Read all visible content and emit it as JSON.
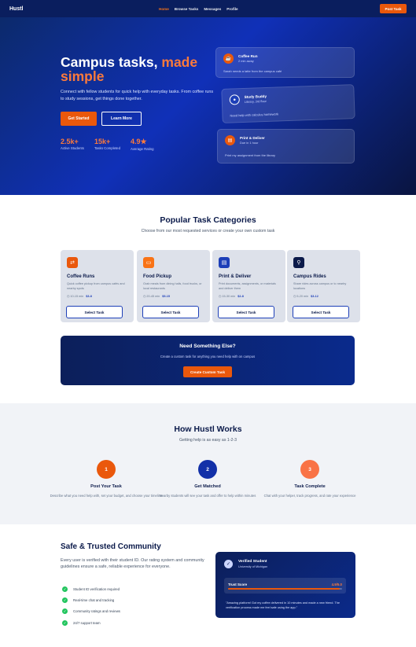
{
  "nav": {
    "logo": "Hustl",
    "links": [
      "Home",
      "Browse Tasks",
      "Messages",
      "Profile"
    ],
    "post_task": "Post Task"
  },
  "hero": {
    "title_part1": "Campus tasks, ",
    "title_accent": "made simple",
    "subtitle": "Connect with fellow students for quick help with everyday tasks. From coffee runs to study sessions, get things done together.",
    "get_started": "Get Started",
    "learn_more": "Learn More",
    "stats": [
      {
        "value": "2.5k+",
        "label": "Active Students"
      },
      {
        "value": "15k+",
        "label": "Tasks Completed"
      },
      {
        "value": "4.9★",
        "label": "Average Rating"
      }
    ],
    "cards": [
      {
        "title": "Coffee Run",
        "meta": "2 min away",
        "desc": "Sarah needs a latte from the campus café",
        "icon": "coffee-icon"
      },
      {
        "title": "Study Buddy",
        "meta": "Library, 3rd floor",
        "desc": "Need help with calculus homework",
        "icon": "book-icon"
      },
      {
        "title": "Print & Deliver",
        "meta": "Due in 1 hour",
        "desc": "Print my assignment from the library",
        "icon": "printer-icon"
      }
    ]
  },
  "categories": {
    "title": "Popular Task Categories",
    "subtitle": "Choose from our most requested services or create your own custom task",
    "items": [
      {
        "name": "Coffee Runs",
        "desc": "Quick coffee pickup from campus cafés and nearby spots",
        "time": "10-15 min",
        "price": "$3-8",
        "button": "Select Task",
        "icon": "coffee-icon",
        "color": "#ea580c"
      },
      {
        "name": "Food Pickup",
        "desc": "Grab meals from dining halls, food trucks, or local restaurants",
        "time": "20-45 min",
        "price": "$5-15",
        "button": "Select Task",
        "icon": "food-icon",
        "color": "#f97316"
      },
      {
        "name": "Print & Deliver",
        "desc": "Print documents, assignments, or materials and deliver them",
        "time": "15-30 min",
        "price": "$2-8",
        "button": "Select Task",
        "icon": "printer-icon",
        "color": "#1d3fb8"
      },
      {
        "name": "Campus Rides",
        "desc": "Share rides across campus or to nearby locations",
        "time": "5-20 min",
        "price": "$3-12",
        "button": "Select Task",
        "icon": "search-icon",
        "color": "#0b1a4a"
      }
    ],
    "custom": {
      "title": "Need Something Else?",
      "subtitle": "Create a custom task for anything you need help with on campus",
      "button": "Create Custom Task"
    }
  },
  "how": {
    "title": "How Hustl Works",
    "subtitle": "Getting help is as easy as 1-2-3",
    "steps": [
      {
        "num": "1",
        "title": "Post Your Task",
        "desc": "Describe what you need help with, set your budget, and choose your timeline",
        "color": "#ea580c"
      },
      {
        "num": "2",
        "title": "Get Matched",
        "desc": "Nearby students will see your task and offer to help within minutes",
        "color": "#1230a8"
      },
      {
        "num": "3",
        "title": "Task Complete",
        "desc": "Chat with your helper, track progress, and rate your experience",
        "color": "#f97346"
      }
    ]
  },
  "trust": {
    "title": "Safe & Trusted Community",
    "subtitle": "Every user is verified with their student ID. Our rating system and community guidelines ensure a safe, reliable experience for everyone.",
    "checks": [
      "Student ID verification required",
      "Real-time chat and tracking",
      "Community ratings and reviews",
      "24/7 support team"
    ],
    "card": {
      "title": "Verified Student",
      "school": "University of Michigan",
      "score_label": "Trust Score",
      "score_value": "4.9/5.0",
      "score_fraction": 0.98,
      "quote": "\"Amazing platform! Got my coffee delivered in 10 minutes and made a new friend. The verification process made me feel safe using the app.\""
    }
  }
}
